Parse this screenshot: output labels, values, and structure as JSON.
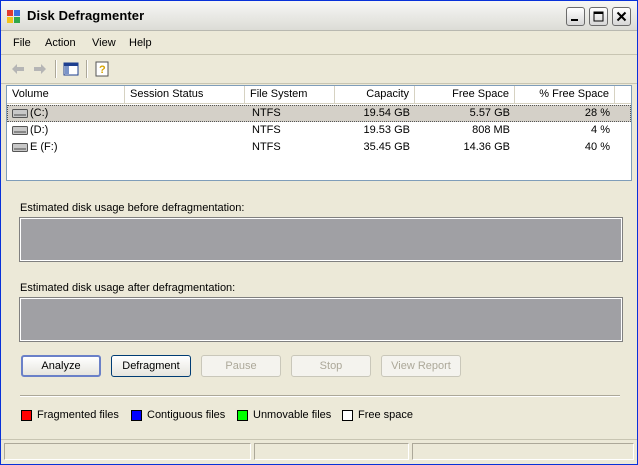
{
  "window": {
    "title": "Disk Defragmenter"
  },
  "menu": {
    "file": "File",
    "action": "Action",
    "view": "View",
    "help": "Help"
  },
  "columns": {
    "volume": "Volume",
    "session_status": "Session Status",
    "file_system": "File System",
    "capacity": "Capacity",
    "free_space": "Free Space",
    "pct_free": "% Free Space"
  },
  "volumes": [
    {
      "name": "(C:)",
      "status": "",
      "fs": "NTFS",
      "capacity": "19.54 GB",
      "free": "5.57 GB",
      "pct": "28 %"
    },
    {
      "name": "(D:)",
      "status": "",
      "fs": "NTFS",
      "capacity": "19.53 GB",
      "free": "808 MB",
      "pct": "4 %"
    },
    {
      "name": "E (F:)",
      "status": "",
      "fs": "NTFS",
      "capacity": "35.45 GB",
      "free": "14.36 GB",
      "pct": "40 %"
    }
  ],
  "usage": {
    "before_label": "Estimated disk usage before defragmentation:",
    "after_label": "Estimated disk usage after defragmentation:"
  },
  "buttons": {
    "analyze": "Analyze",
    "defragment": "Defragment",
    "pause": "Pause",
    "stop": "Stop",
    "view_report": "View Report"
  },
  "legend": {
    "fragmented": {
      "label": "Fragmented files",
      "color": "#ff0000"
    },
    "contiguous": {
      "label": "Contiguous files",
      "color": "#0000ff"
    },
    "unmovable": {
      "label": "Unmovable files",
      "color": "#00ff00"
    },
    "free": {
      "label": "Free space",
      "color": "#ffffff"
    }
  },
  "colors": {
    "usage_area": "#a0a0a4",
    "accent": "#0831d9"
  }
}
